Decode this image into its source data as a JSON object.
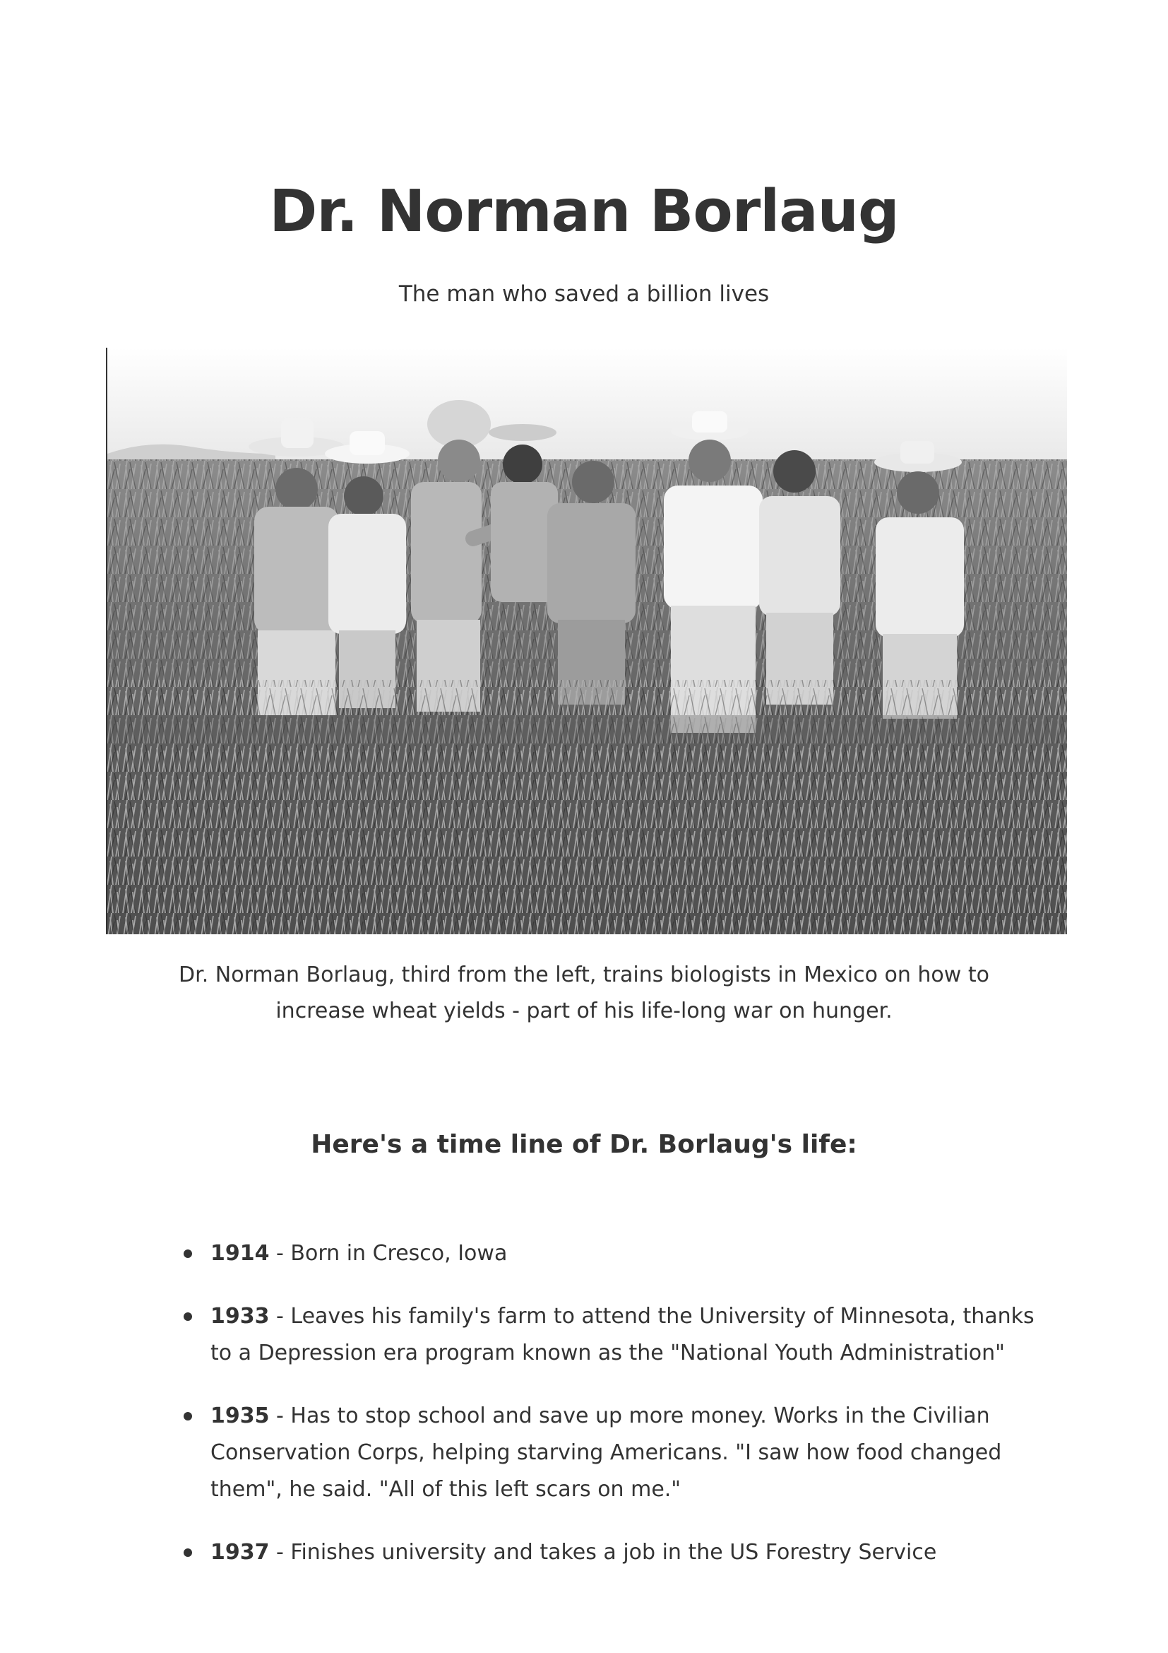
{
  "header": {
    "title": "Dr. Norman Borlaug",
    "subtitle": "The man who saved a billion lives"
  },
  "photo": {
    "caption": "Dr. Norman Borlaug, third from the left, trains biologists in Mexico on how to increase wheat yields - part of his life-long war on hunger."
  },
  "timeline": {
    "heading": "Here's a time line of Dr. Borlaug's life:",
    "items": [
      {
        "year": "1914",
        "text": " - Born in Cresco, Iowa"
      },
      {
        "year": "1933",
        "text": " - Leaves his family's farm to attend the University of Minnesota, thanks to a Depression era program known as the \"National Youth Administration\""
      },
      {
        "year": "1935",
        "text": " - Has to stop school and save up more money. Works in the Civilian Conservation Corps, helping starving Americans. \"I saw how food changed them\", he said. \"All of this left scars on me.\""
      },
      {
        "year": "1937",
        "text": " - Finishes university and takes a job in the US Forestry Service"
      }
    ]
  }
}
